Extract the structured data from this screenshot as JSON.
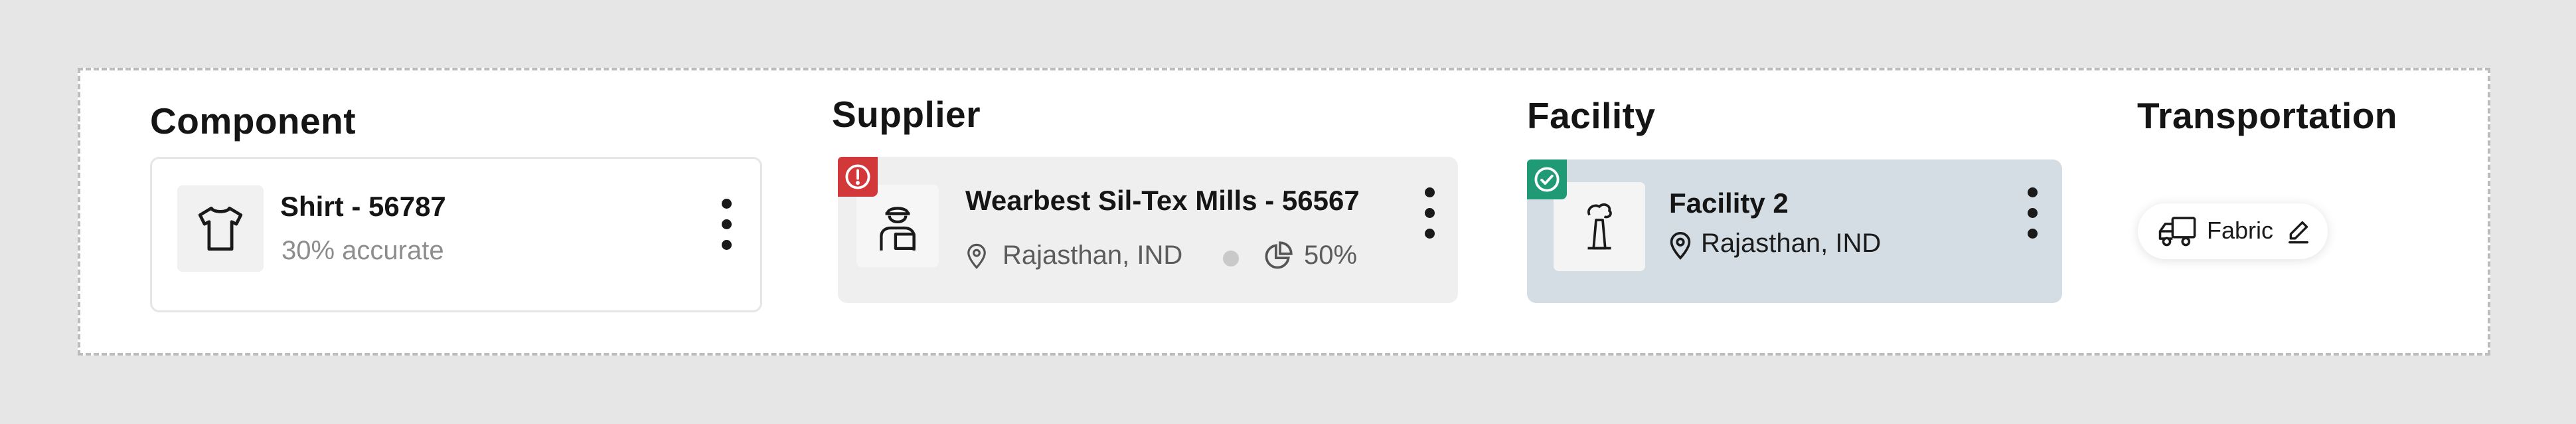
{
  "colors": {
    "page_bg": "#e6e6e6",
    "error_badge": "#d2373a",
    "success_badge": "#1f9a74",
    "facility_card_bg": "#d4dde3",
    "supplier_card_bg": "#efefef"
  },
  "component": {
    "heading": "Component",
    "card": {
      "title": "Shirt - 56787",
      "subtitle": "30% accurate",
      "icon": "shirt-icon"
    }
  },
  "supplier": {
    "heading": "Supplier",
    "card": {
      "title": "Wearbest Sil-Tex Mills - 56567",
      "location": "Rajasthan, IND",
      "percent": "50%",
      "badge": "error",
      "icon": "worker-icon"
    }
  },
  "facility": {
    "heading": "Facility",
    "card": {
      "title": "Facility 2",
      "location": "Rajasthan, IND",
      "badge": "verified",
      "icon": "factory-icon"
    }
  },
  "transportation": {
    "heading": "Transportation",
    "chip": {
      "label": "Fabric",
      "icon": "truck-icon"
    }
  }
}
